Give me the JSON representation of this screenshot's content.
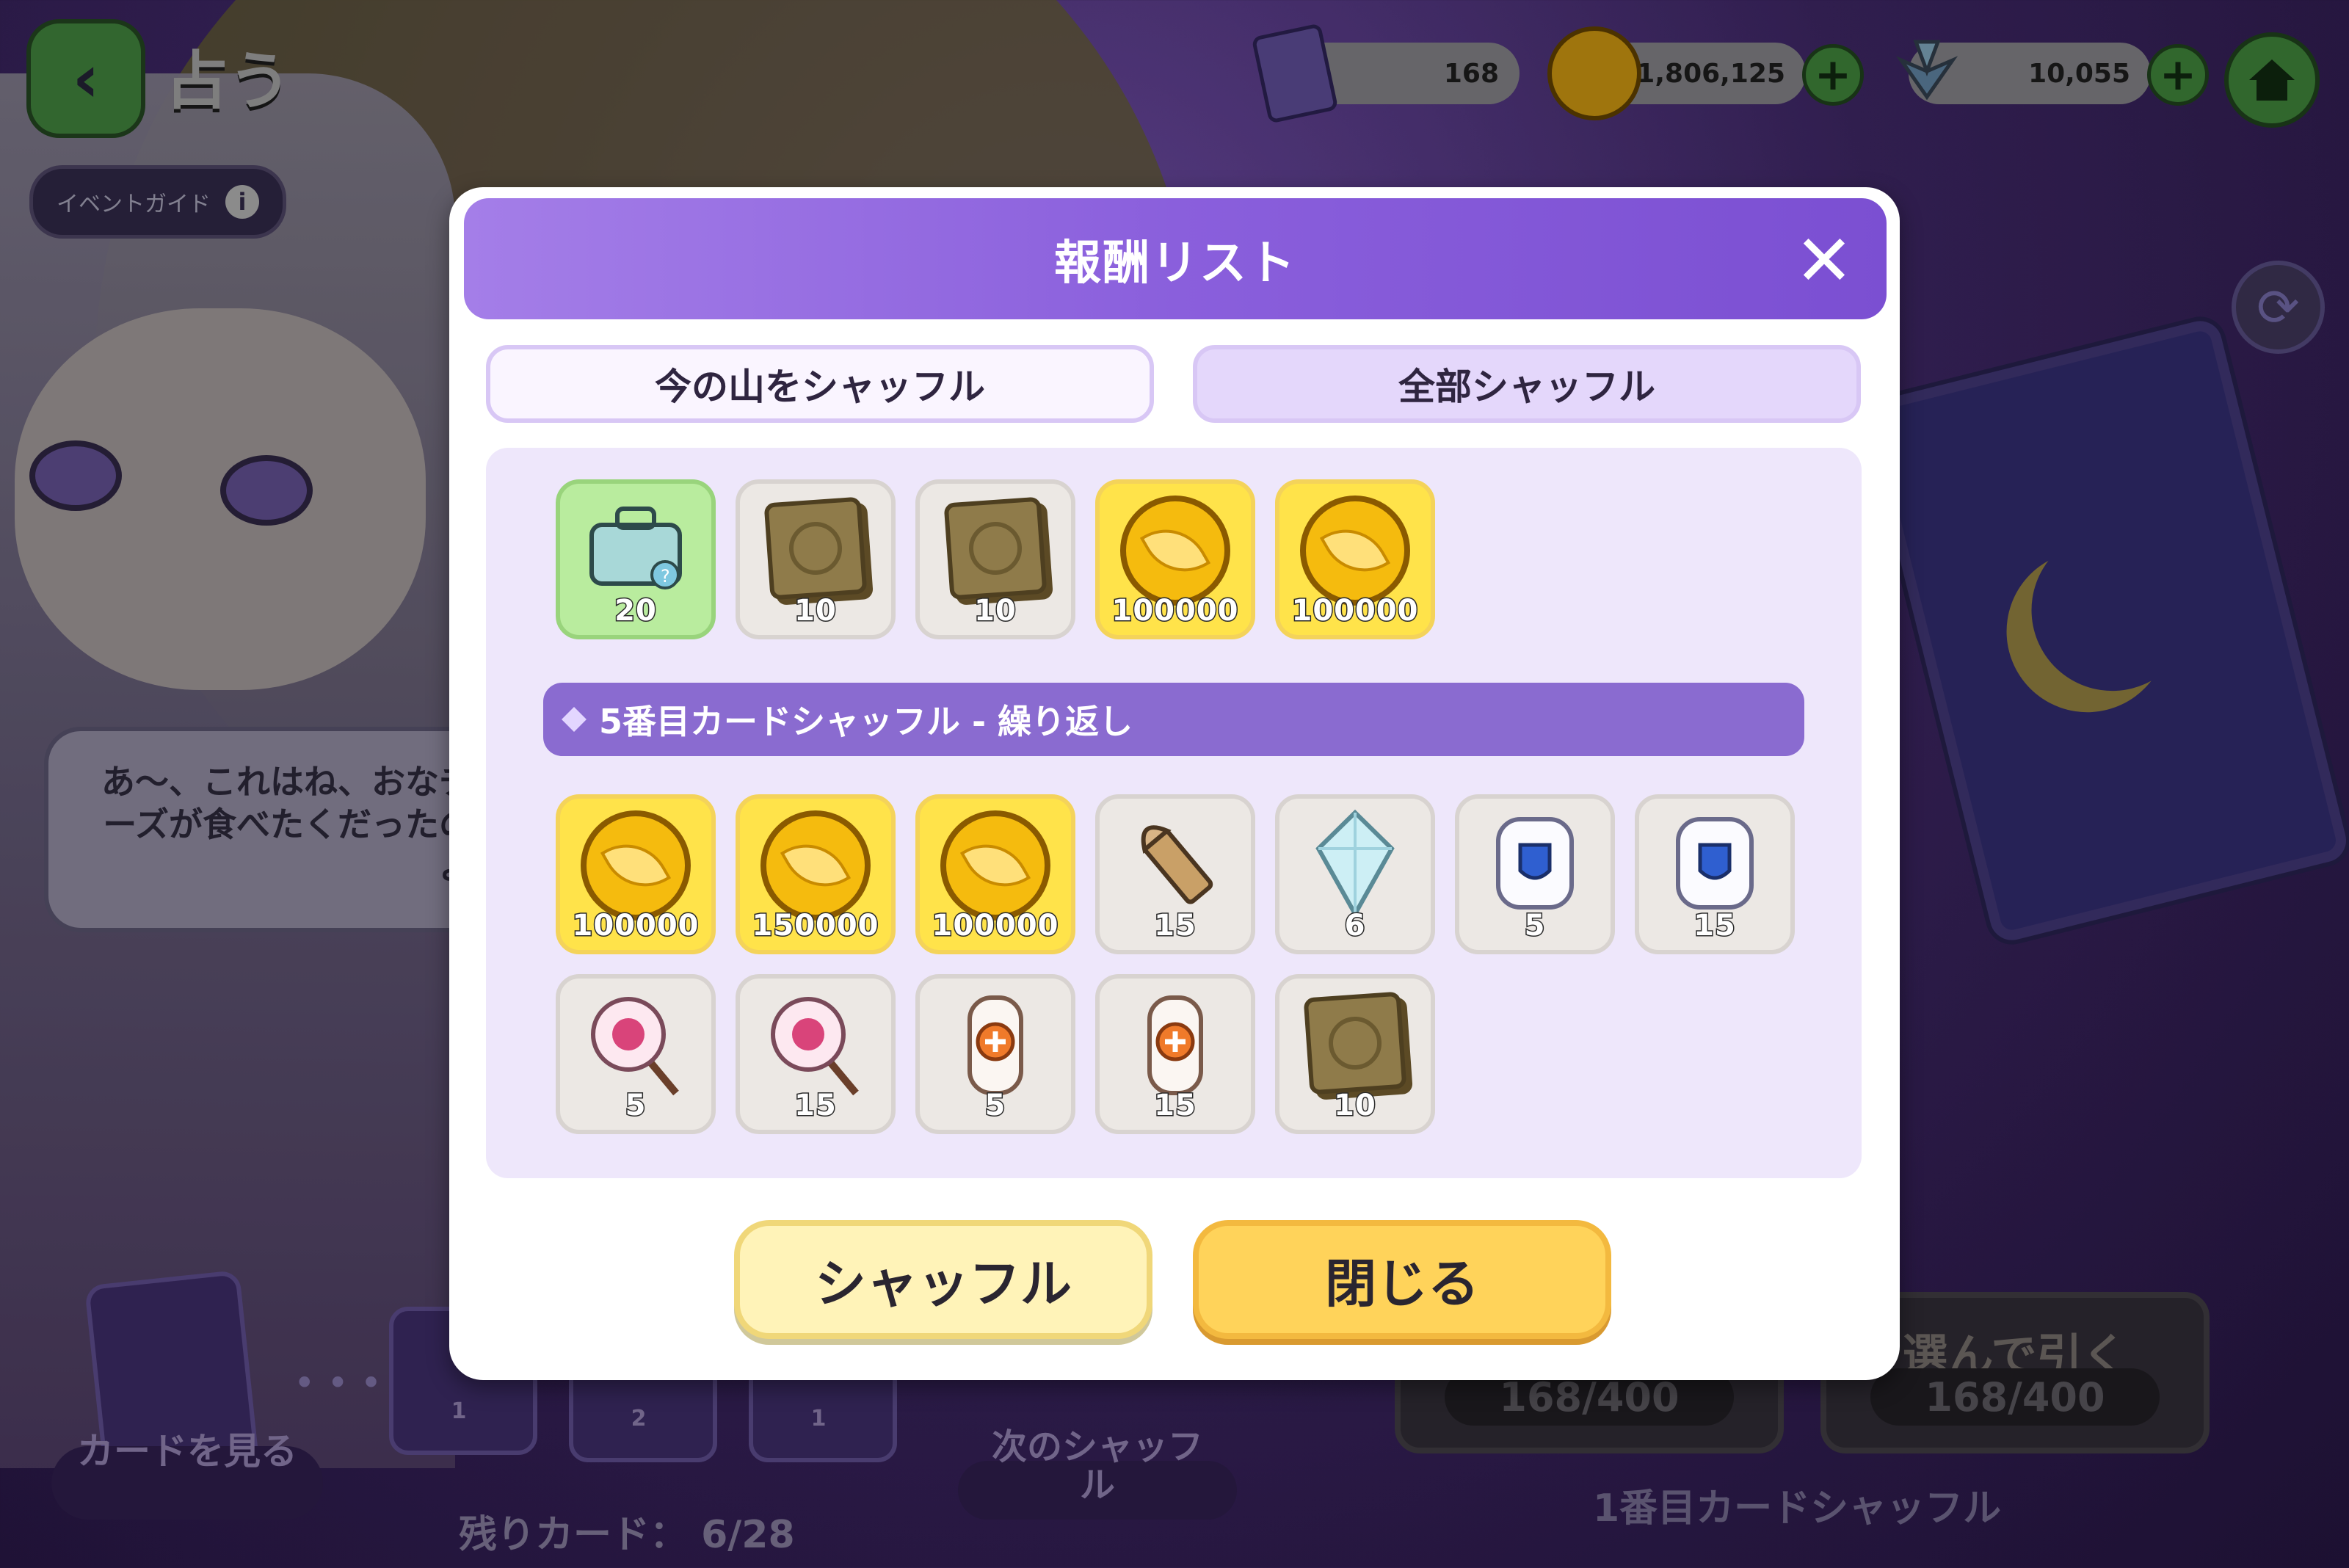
{
  "game": {
    "title": "占う",
    "event_guide": "イベントガイド",
    "resources": [
      {
        "name": "card-ticket",
        "value": "168"
      },
      {
        "name": "coin",
        "value": "1,806,125"
      },
      {
        "name": "crystal",
        "value": "10,055"
      }
    ],
    "dialogue": "あ～、これはね、おなチーズが食べたくだったのよ",
    "view_cards": "カードを見る",
    "next_shuffle": "次のシャッフル",
    "remaining_cards": "残りカード： 6/28",
    "draw_count_a": "168/400",
    "draw_pick_label": "選んで引く",
    "draw_count_b": "168/400",
    "first_shuffle": "1番目カードシャッフル",
    "mini_card_counts": [
      "1",
      "2",
      "1"
    ]
  },
  "modal": {
    "title": "報酬リスト",
    "close_glyph": "✕",
    "tab_shuffle_current": "今の山をシャッフル",
    "tab_shuffle_all": "全部シャッフル",
    "section_title": "5番目カードシャッフル - 繰り返し",
    "row1": [
      {
        "icon": "mystery-box-icon",
        "qty": "20",
        "style": "green"
      },
      {
        "icon": "cookie-card-icon",
        "qty": "10",
        "style": "grey"
      },
      {
        "icon": "cookie-card-icon",
        "qty": "10",
        "style": "grey"
      },
      {
        "icon": "coin-icon",
        "qty": "100000",
        "style": "gold"
      },
      {
        "icon": "coin-icon",
        "qty": "100000",
        "style": "gold"
      }
    ],
    "row2": [
      {
        "icon": "coin-icon",
        "qty": "100000",
        "style": "gold"
      },
      {
        "icon": "coin-icon",
        "qty": "150000",
        "style": "gold"
      },
      {
        "icon": "coin-icon",
        "qty": "100000",
        "style": "gold"
      },
      {
        "icon": "bullet-icon",
        "qty": "15",
        "style": "grey"
      },
      {
        "icon": "crystal-icon",
        "qty": "6",
        "style": "grey"
      },
      {
        "icon": "marshmallow-shield-icon",
        "qty": "5",
        "style": "grey"
      },
      {
        "icon": "marshmallow-shield-icon",
        "qty": "15",
        "style": "grey"
      }
    ],
    "row3": [
      {
        "icon": "marshmallow-stick-icon",
        "qty": "5",
        "style": "grey"
      },
      {
        "icon": "marshmallow-stick-icon",
        "qty": "15",
        "style": "grey"
      },
      {
        "icon": "bandage-icon",
        "qty": "5",
        "style": "grey"
      },
      {
        "icon": "bandage-icon",
        "qty": "15",
        "style": "grey"
      },
      {
        "icon": "cookie-card-icon",
        "qty": "10",
        "style": "grey"
      }
    ],
    "btn_shuffle": "シャッフル",
    "btn_close": "閉じる"
  },
  "colors": {
    "header_purple": "#8a5fdc",
    "gold": "#ffe34a",
    "green_button": "#3c7e38"
  }
}
